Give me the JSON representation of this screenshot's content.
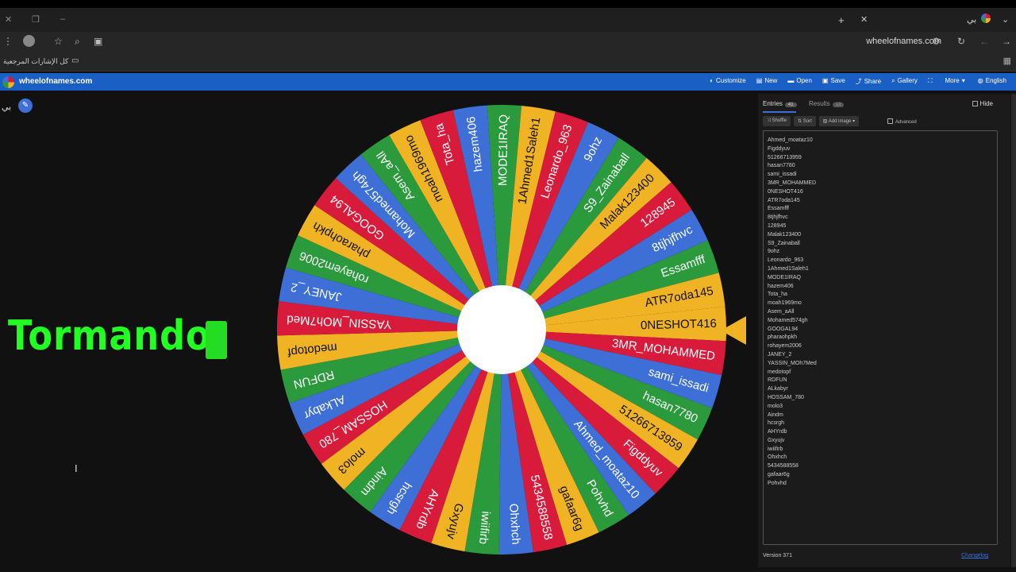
{
  "browser": {
    "url": "wheelofnames.com",
    "bookmark_folder": "كل الإشارات المرجعية",
    "profile_label": "بي"
  },
  "app": {
    "title": "wheelofnames.com",
    "menu": [
      {
        "icon": "palette-icon",
        "label": "Customize"
      },
      {
        "icon": "new-file-icon",
        "label": "New"
      },
      {
        "icon": "folder-icon",
        "label": "Open"
      },
      {
        "icon": "save-icon",
        "label": "Save"
      },
      {
        "icon": "share-icon",
        "label": "Share"
      },
      {
        "icon": "search-icon",
        "label": "Gallery"
      },
      {
        "icon": "fullscreen-icon",
        "label": ""
      },
      {
        "icon": "chevron-down-icon",
        "label": "More"
      },
      {
        "icon": "globe-icon",
        "label": "English"
      }
    ]
  },
  "left": {
    "user_label": "بي",
    "overlay_text": "Tormando"
  },
  "wheel": {
    "colors": [
      "#f0b323",
      "#d81b3a",
      "#3d6fd6",
      "#2a9a3c"
    ],
    "pointer_color": "#f0b323",
    "entries_on_wheel": [
      "0NESHOT416",
      "3MR_MOHAMMED",
      "sami_issadi",
      "hasan7780",
      "51266713959",
      "Figddyuv",
      "Ahmed_moataz10",
      "Pohvhd",
      "gafaar6g",
      "5434588558",
      "Ohxhch",
      "iwiifirb",
      "Gxyujv",
      "AHYrdb",
      "hcsrgh",
      "Aindm",
      "molo3",
      "HOSSAM_780",
      "ALkabyr",
      "RDFUN",
      "medotopf",
      "YASSIN_MOh7Med",
      "JANEY_2",
      "rohayem2006",
      "pharaohpkh",
      "GOOGAL94",
      "Mohamed574gh",
      "Asem_aAll",
      "moah1969mo",
      "Tota_ha",
      "hazem406",
      "MODE1IRAQ",
      "1Ahmed1Saleh1",
      "Leonardo_963",
      "9ohz",
      "S9_Zainaball",
      "Malak123400",
      "128945",
      "8tjhjfhvc",
      "Essamfff",
      "ATR7oda145"
    ]
  },
  "panel": {
    "tabs": [
      {
        "label": "Entries",
        "count": "41"
      },
      {
        "label": "Results",
        "count": "13"
      }
    ],
    "hide_label": "Hide",
    "toolbar": [
      {
        "icon": "shuffle-icon",
        "label": "Shuffle"
      },
      {
        "icon": "sort-icon",
        "label": "Sort"
      },
      {
        "icon": "image-icon",
        "label": "Add image"
      }
    ],
    "advanced_label": "Advanced",
    "entries": [
      "Ahmed_moataz10",
      "Figddyuv",
      "51266713959",
      "hasan7780",
      "sami_issadi",
      "3MR_MOHAMMED",
      "0NESHOT416",
      "ATR7oda145",
      "Essamfff",
      "8tjhjfhvc",
      "128945",
      "Malak123400",
      "S9_Zainaball",
      "9ohz",
      "Leonardo_963",
      "1Ahmed1Saleh1",
      "MODE1IRAQ",
      "hazem406",
      "Tota_ha",
      "moah1969mo",
      "Asem_aAll",
      "Mohamed574gh",
      "GOOGAL94",
      "pharaohpkh",
      "rohayem2006",
      "JANEY_2",
      "YASSIN_MOh7Med",
      "medotopf",
      "RDFUN",
      "ALkabyr",
      "HOSSAM_780",
      "molo3",
      "Aindm",
      "hcsrgh",
      "AHYrdb",
      "Gxyujv",
      "iwiifirb",
      "Ohxhch",
      "5434588558",
      "gafaar6g",
      "Pohvhd"
    ],
    "version": "Version 371",
    "changelog": "Changelog"
  }
}
